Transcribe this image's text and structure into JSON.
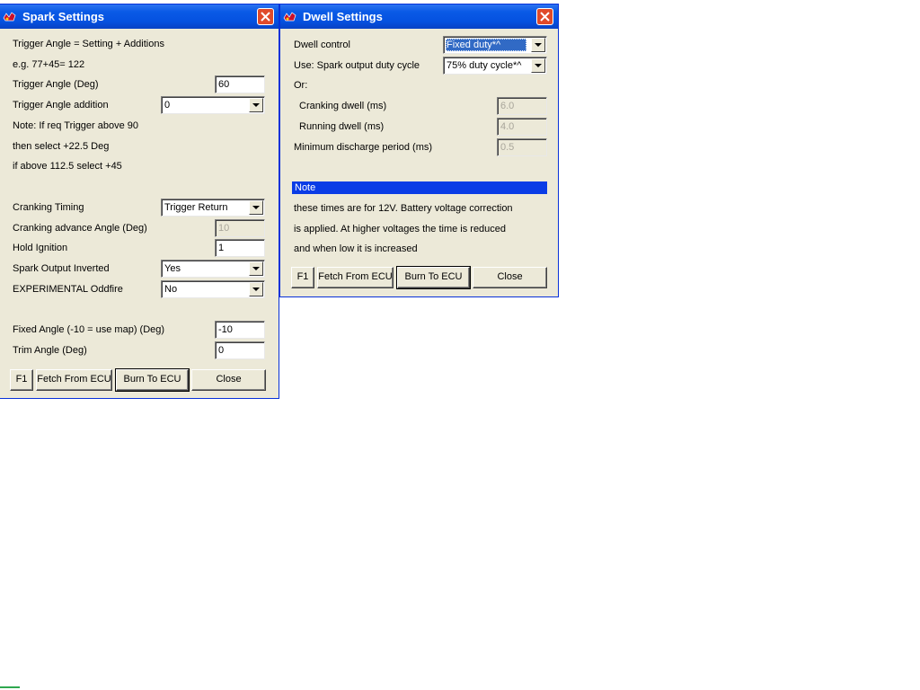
{
  "spark": {
    "title": "Spark Settings",
    "info1": "Trigger Angle = Setting + Additions",
    "info2": "e.g. 77+45= 122",
    "trigger_angle_label": "Trigger Angle  (Deg)",
    "trigger_angle_value": "60",
    "addition_label": "Trigger Angle addition",
    "addition_value": "0",
    "note1": "Note: If req Trigger above 90",
    "note2": "then select +22.5 Deg",
    "note3": "if above 112.5 select +45",
    "cranking_timing_label": "Cranking Timing",
    "cranking_timing_value": "Trigger Return",
    "cranking_advance_label": "Cranking advance Angle (Deg)",
    "cranking_advance_value": "10",
    "hold_ignition_label": "Hold Ignition",
    "hold_ignition_value": "1",
    "spark_inverted_label": "Spark Output Inverted",
    "spark_inverted_value": "Yes",
    "oddfire_label": "EXPERIMENTAL Oddfire",
    "oddfire_value": "No",
    "fixed_angle_label": "Fixed Angle (-10 = use map) (Deg)",
    "fixed_angle_value": "-10",
    "trim_angle_label": "Trim Angle (Deg)",
    "trim_angle_value": "0",
    "buttons": {
      "f1": "F1",
      "fetch": "Fetch From ECU",
      "burn": "Burn To ECU",
      "close": "Close"
    }
  },
  "dwell": {
    "title": "Dwell Settings",
    "dwell_control_label": "Dwell control",
    "dwell_control_value": "Fixed duty*^",
    "use_label": "Use: Spark output duty cycle",
    "use_value": "75% duty cycle*^",
    "or_label": "Or:",
    "cranking_dwell_label": "Cranking dwell (ms)",
    "cranking_dwell_value": "6.0",
    "running_dwell_label": "Running dwell (ms)",
    "running_dwell_value": "4.0",
    "min_discharge_label": "Minimum discharge period (ms)",
    "min_discharge_value": "0.5",
    "note_header": "Note",
    "note1": "these times are for 12V. Battery voltage correction",
    "note2": "is applied. At higher voltages the time is reduced",
    "note3": "and when low it is increased",
    "buttons": {
      "f1": "F1",
      "fetch": "Fetch From ECU",
      "burn": "Burn To ECU",
      "close": "Close"
    }
  },
  "icons": {
    "app": "megasquirt-app-icon",
    "close": "close-x-icon",
    "dropdown": "chevron-down-icon"
  },
  "colors": {
    "titlebar": "#0a5ae6",
    "window_bg": "#ece9d8",
    "close_button": "#e04a2a",
    "selection": "#316ac5",
    "note_bar": "#0a3ce6"
  }
}
